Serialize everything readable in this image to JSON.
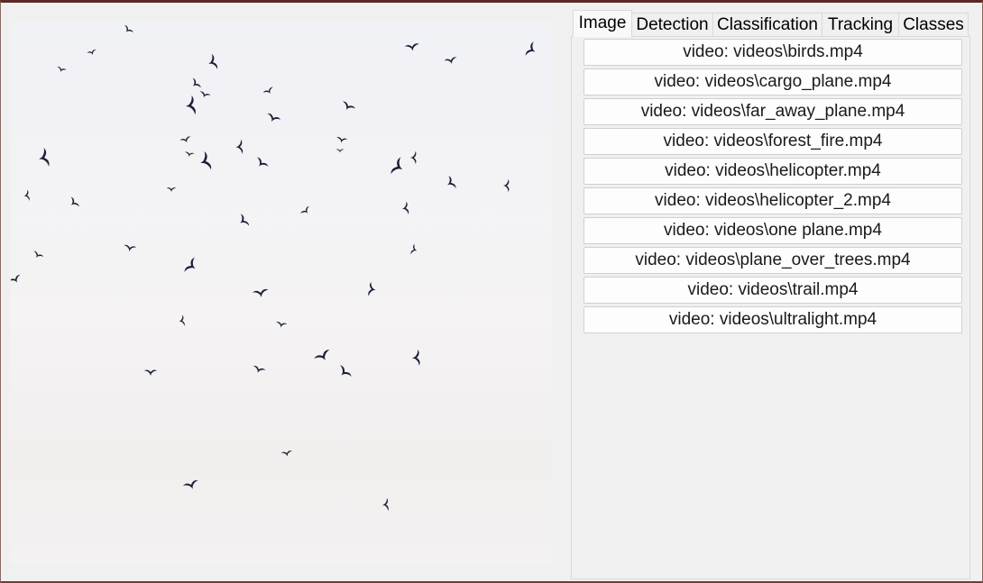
{
  "tabs": [
    {
      "label": "Image",
      "selected": true
    },
    {
      "label": "Detection",
      "selected": false
    },
    {
      "label": "Classification",
      "selected": false
    },
    {
      "label": "Tracking",
      "selected": false
    },
    {
      "label": "Classes",
      "selected": false
    }
  ],
  "video_buttons": [
    "video: videos\\birds.mp4",
    "video: videos\\cargo_plane.mp4",
    "video: videos\\far_away_plane.mp4",
    "video: videos\\forest_fire.mp4",
    "video: videos\\helicopter.mp4",
    "video: videos\\helicopter_2.mp4",
    "video: videos\\one plane.mp4",
    "video: videos\\plane_over_trees.mp4",
    "video: videos\\trail.mp4",
    "video: videos\\ultralight.mp4"
  ],
  "colors": {
    "frame_border": "#5a2a22",
    "sky": "#f2f2f5",
    "bird": "#1d1f38",
    "button_bg": "#fdfdfd",
    "window_bg": "#f0f0f0"
  },
  "video_frame": {
    "subject": "flock of birds against pale sky"
  }
}
